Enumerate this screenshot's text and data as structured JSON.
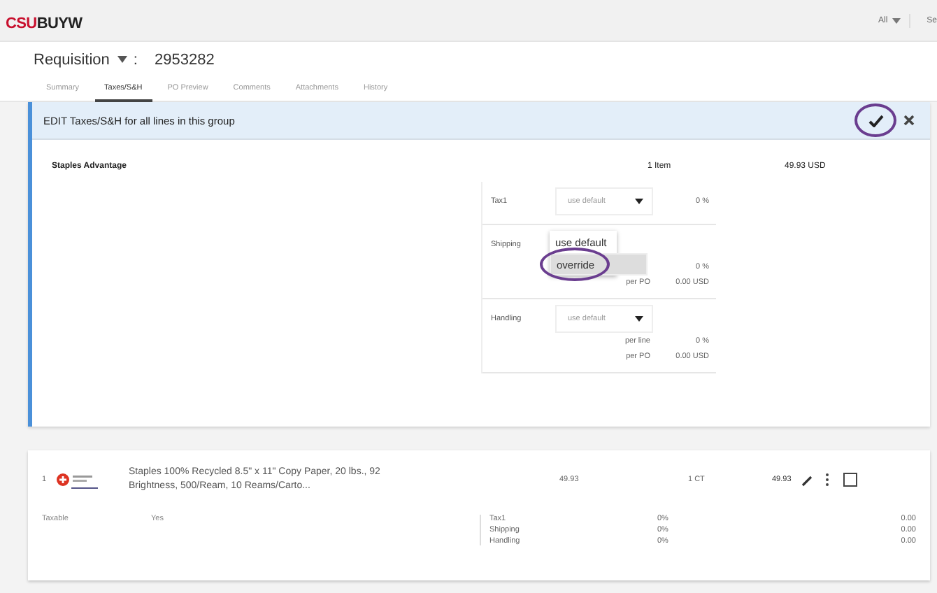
{
  "header": {
    "logo": "CSUBUYW",
    "scope": "All",
    "search_cut": "Se"
  },
  "requisition": {
    "label": "Requisition",
    "separator": ":",
    "number": "2953282"
  },
  "tabs": [
    {
      "label": "Summary",
      "selected": false
    },
    {
      "label": "Taxes/S&H",
      "selected": true
    },
    {
      "label": "PO Preview",
      "selected": false
    },
    {
      "label": "Comments",
      "selected": false
    },
    {
      "label": "Attachments",
      "selected": false
    },
    {
      "label": "History",
      "selected": false
    }
  ],
  "edit_panel": {
    "title": "EDIT Taxes/S&H for all lines in this group",
    "confirm_circled": true,
    "supplier": "Staples Advantage",
    "items": "1 Item",
    "total": "49.93 USD",
    "charges": [
      {
        "label": "Tax1",
        "expanded": false,
        "select": "use default",
        "value": "0 %"
      },
      {
        "label": "Shipping",
        "expanded": true,
        "options": [
          {
            "label": "use default",
            "selected": false,
            "circled": false
          },
          {
            "label": "override",
            "selected": true,
            "circled": true
          }
        ],
        "lines": [
          {
            "value": "0 %"
          },
          {
            "label": "per PO",
            "value": "0.00 USD"
          }
        ]
      },
      {
        "label": "Handling",
        "expanded": false,
        "select": "use default",
        "lines": [
          {
            "label": "per line",
            "value": "0 %"
          },
          {
            "label": "per PO",
            "value": "0.00 USD"
          }
        ]
      }
    ]
  },
  "line_items": [
    {
      "number": "1",
      "description": "Staples 100% Recycled 8.5\" x 11\" Copy Paper, 20 lbs., 92 Brightness, 500/Ream, 10 Reams/Carto...",
      "price": "49.93",
      "quantity": "1 CT",
      "total": "49.93",
      "checked": false,
      "taxable_label": "Taxable",
      "taxable_value": "Yes",
      "charges": [
        {
          "name": "Tax1",
          "rate": "0%",
          "amount": "0.00"
        },
        {
          "name": "Shipping",
          "rate": "0%",
          "amount": "0.00"
        },
        {
          "name": "Handling",
          "rate": "0%",
          "amount": "0.00"
        }
      ]
    }
  ]
}
